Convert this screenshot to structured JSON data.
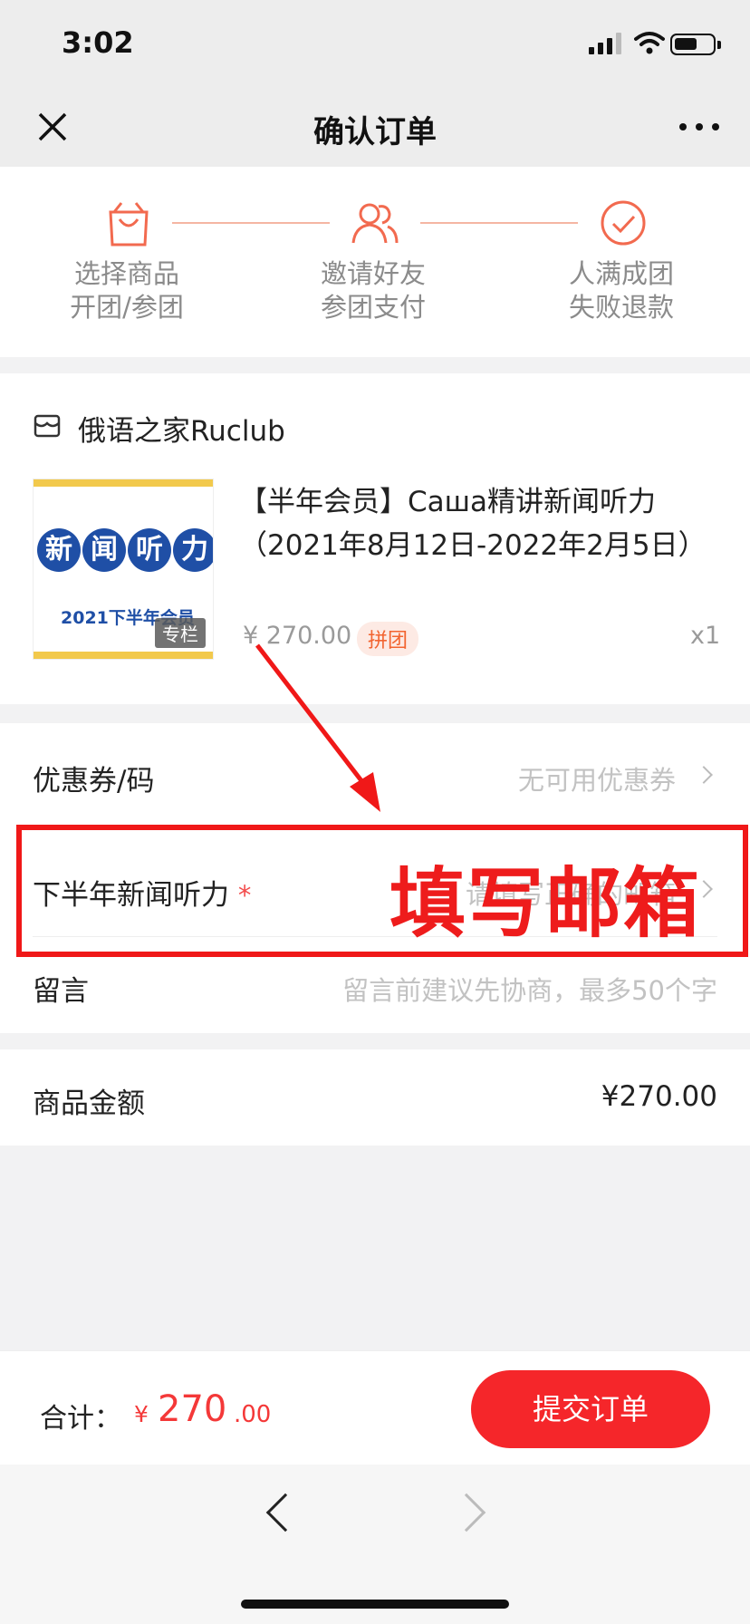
{
  "status_bar": {
    "time": "3:02"
  },
  "nav": {
    "title": "确认订单"
  },
  "steps": [
    {
      "line1": "选择商品",
      "line2": "开团/参团",
      "icon": "shopping-bag-icon"
    },
    {
      "line1": "邀请好友",
      "line2": "参团支付",
      "icon": "people-icon"
    },
    {
      "line1": "人满成团",
      "line2": "失败退款",
      "icon": "check-circle-icon"
    }
  ],
  "shop": {
    "name": "俄语之家Ruclub"
  },
  "product": {
    "title": "【半年会员】Саша精讲新闻听力（2021年8月12日-2022年2月5日）",
    "price": "¥ 270.00",
    "badge": "拼团",
    "qty": "x1",
    "thumb_chars": [
      "新",
      "闻",
      "听",
      "力"
    ],
    "thumb_sub": "2021下半年会员",
    "thumb_tag": "专栏"
  },
  "coupon": {
    "label": "优惠券/码",
    "value": "无可用优惠券"
  },
  "form_field": {
    "label": "下半年新闻听力",
    "required_mark": "*",
    "placeholder": "请填写正确的邮箱"
  },
  "message": {
    "label": "留言",
    "placeholder": "留言前建议先协商，最多50个字"
  },
  "amount": {
    "label": "商品金额",
    "value": "¥270.00"
  },
  "footer": {
    "total_label": "合计：",
    "currency": "¥",
    "total_int": "270",
    "total_dec": ".00",
    "submit": "提交订单"
  },
  "annotation": {
    "text": "填写邮箱"
  },
  "colors": {
    "accent": "#f5262a",
    "step_accent": "#f26a4f",
    "annotation": "#f01818"
  }
}
